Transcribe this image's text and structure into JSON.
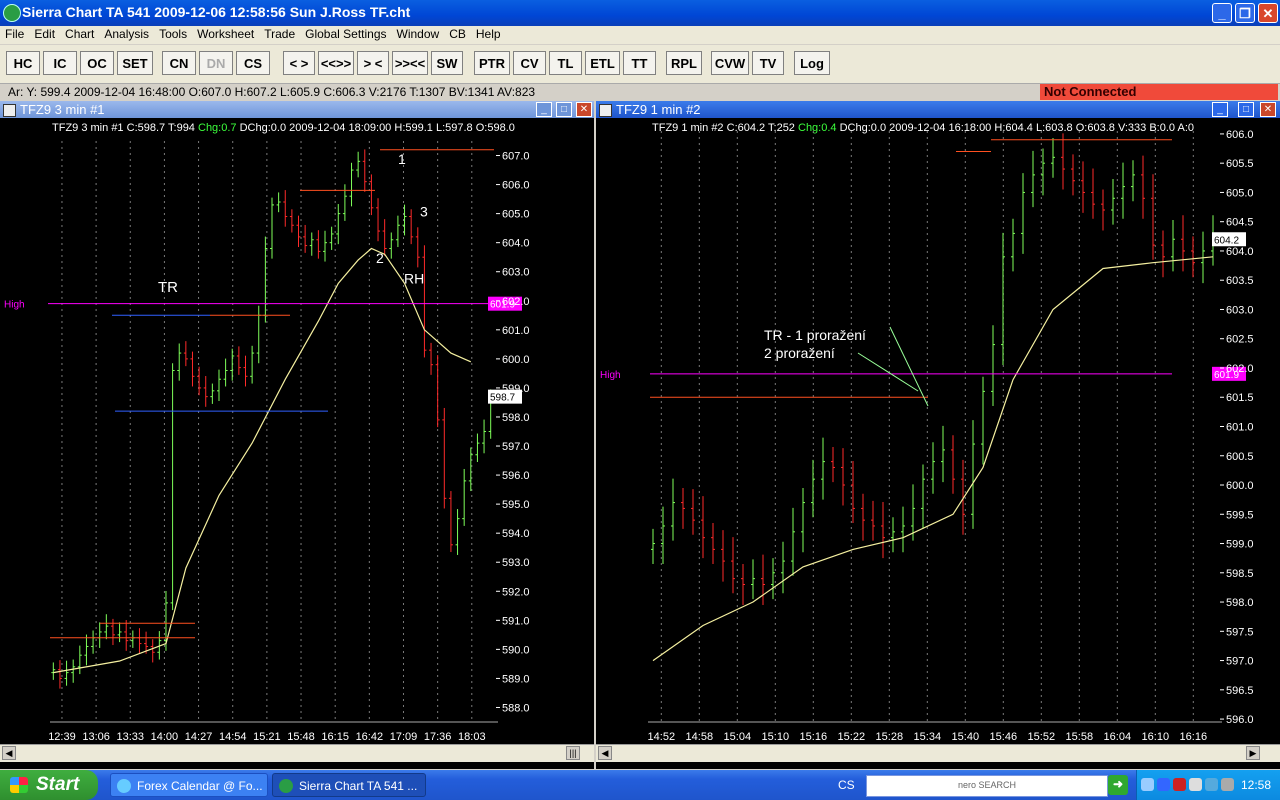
{
  "window": {
    "title": "Sierra Chart TA 541   2009-12-06   12:58:56   Sun    J.Ross TF.cht"
  },
  "menu": [
    "File",
    "Edit",
    "Chart",
    "Analysis",
    "Tools",
    "Worksheet",
    "Trade",
    "Global Settings",
    "Window",
    "CB",
    "Help"
  ],
  "toolbar": [
    "HC",
    "IC",
    "OC",
    "SET",
    "CN",
    "DN",
    "CS",
    "< >",
    "<<>>",
    "> <",
    ">><<",
    "SW",
    "PTR",
    "CV",
    "TL",
    "ETL",
    "TT",
    "RPL",
    "CVW",
    "TV",
    "Log"
  ],
  "status": {
    "info": "Ar: Y: 599.4   2009-12-04   16:48:00   O:607.0   H:607.2   L:605.9   C:606.3   V:2176   T:1307   BV:1341   AV:823",
    "connection": "Not Connected"
  },
  "chart1": {
    "window_title": "TFZ9   3 min   #1",
    "header": {
      "symbol": "TFZ9",
      "interval": "3 min",
      "num": "#1",
      "close": "C:598.7",
      "trades": "T:994",
      "chg": "Chg:0.7",
      "dchg": "DChg:0.0",
      "date": "2009-12-04",
      "time": "18:09:00",
      "high": "H:599.1",
      "low": "L:597.8",
      "open": "O:598.0"
    },
    "high_label": "High",
    "high_price_label": "601.9",
    "last_price_label": "598.7",
    "annotations": [
      "TR",
      "1",
      "2",
      "3",
      "RH"
    ]
  },
  "chart2": {
    "window_title": "TFZ9   1 min   #2",
    "header": {
      "symbol": "TFZ9",
      "interval": "1 min",
      "num": "#2",
      "close": "C:604.2",
      "trades": "T:252",
      "chg": "Chg:0.4",
      "dchg": "DChg:0.0",
      "date": "2009-12-04",
      "time": "16:18:00",
      "high": "H:604.4",
      "low": "L:603.8",
      "open": "O:603.8",
      "volume": "V:333",
      "bid": "B:0.0",
      "ask": "A:0"
    },
    "high_label": "High",
    "high_price_label": "601.9",
    "last_price_label": "604.2",
    "annotation_line1": "TR - 1 proražení",
    "annotation_line2": "2 proražení"
  },
  "chart_data": [
    {
      "type": "bar",
      "title": "TFZ9   3 min   #1",
      "ylim": [
        587.5,
        607.5
      ],
      "y_ticks": [
        "607.0",
        "606.0",
        "605.0",
        "604.0",
        "603.0",
        "602.0",
        "601.0",
        "600.0",
        "599.0",
        "598.0",
        "597.0",
        "596.0",
        "595.0",
        "594.0",
        "593.0",
        "592.0",
        "591.0",
        "590.0",
        "589.0",
        "588.0"
      ],
      "x_ticks": [
        "12:39",
        "13:06",
        "13:33",
        "14:00",
        "14:27",
        "14:54",
        "15:21",
        "15:48",
        "16:15",
        "16:42",
        "17:09",
        "17:36",
        "18:03"
      ],
      "high_line": 601.9,
      "close": [
        589.3,
        589.0,
        589.2,
        589.4,
        589.8,
        590.1,
        590.4,
        590.6,
        590.8,
        590.5,
        590.6,
        590.3,
        590.4,
        590.2,
        590.1,
        589.9,
        590.3,
        591.6,
        599.6,
        600.2,
        600.0,
        599.4,
        599.0,
        598.7,
        598.9,
        599.3,
        599.6,
        600.1,
        599.7,
        599.4,
        600.2,
        601.5,
        603.8,
        605.3,
        605.4,
        604.9,
        604.6,
        604.2,
        603.9,
        604.1,
        603.7,
        604.0,
        604.3,
        605.0,
        605.6,
        606.5,
        606.8,
        606.1,
        605.2,
        604.4,
        603.8,
        604.1,
        604.6,
        604.9,
        604.2,
        603.5,
        600.3,
        599.8,
        597.9,
        595.2,
        593.6,
        594.5,
        595.8,
        596.7,
        597.1,
        597.5,
        598.7
      ],
      "moving_average": [
        [
          0,
          589.2
        ],
        [
          10,
          589.6
        ],
        [
          17,
          590.2
        ],
        [
          20,
          592.8
        ],
        [
          25,
          595.3
        ],
        [
          30,
          597.1
        ],
        [
          35,
          599.3
        ],
        [
          40,
          601.3
        ],
        [
          43,
          602.6
        ],
        [
          46,
          603.4
        ],
        [
          48,
          603.8
        ],
        [
          50,
          603.6
        ],
        [
          53,
          602.6
        ],
        [
          56,
          601.0
        ],
        [
          60,
          600.2
        ],
        [
          63,
          599.9
        ]
      ]
    },
    {
      "type": "bar",
      "title": "TFZ9   1 min   #2",
      "ylim": [
        595.95,
        606.05
      ],
      "y_ticks": [
        "606.0",
        "605.5",
        "605.0",
        "604.5",
        "604.0",
        "603.5",
        "603.0",
        "602.5",
        "602.0",
        "601.5",
        "601.0",
        "600.5",
        "600.0",
        "599.5",
        "599.0",
        "598.5",
        "598.0",
        "597.5",
        "597.0",
        "596.5",
        "596.0"
      ],
      "x_ticks": [
        "14:52",
        "14:58",
        "15:04",
        "15:10",
        "15:16",
        "15:22",
        "15:28",
        "15:34",
        "15:40",
        "15:46",
        "15:52",
        "15:58",
        "16:04",
        "16:10",
        "16:16"
      ],
      "high_line": 601.9,
      "close": [
        599.0,
        599.3,
        599.7,
        599.6,
        599.4,
        599.1,
        598.9,
        598.7,
        598.4,
        598.3,
        598.4,
        598.3,
        598.5,
        598.7,
        599.2,
        599.7,
        600.1,
        600.4,
        600.3,
        600.0,
        599.6,
        599.4,
        599.3,
        599.1,
        599.2,
        599.3,
        599.6,
        600.1,
        600.4,
        600.6,
        600.1,
        599.5,
        600.7,
        601.6,
        602.4,
        603.9,
        604.3,
        605.0,
        605.3,
        605.5,
        605.6,
        605.4,
        605.2,
        605.0,
        604.8,
        604.7,
        604.9,
        605.1,
        605.3,
        604.9,
        604.1,
        603.9,
        604.2,
        604.0,
        603.8,
        604.0,
        604.2
      ],
      "moving_average": [
        [
          0,
          597.0
        ],
        [
          5,
          597.6
        ],
        [
          10,
          598.0
        ],
        [
          15,
          598.6
        ],
        [
          20,
          598.9
        ],
        [
          25,
          599.1
        ],
        [
          30,
          599.5
        ],
        [
          33,
          600.3
        ],
        [
          36,
          601.8
        ],
        [
          40,
          603.0
        ],
        [
          45,
          603.7
        ],
        [
          50,
          603.8
        ],
        [
          56,
          603.9
        ]
      ]
    }
  ],
  "taskbar": {
    "start": "Start",
    "tasks": [
      "Forex Calendar @ Fo...",
      "Sierra Chart TA 541 ..."
    ],
    "lang": "CS",
    "search": "nero SEARCH",
    "clock": "12:58"
  },
  "colors": {
    "bull": "#7fff5a",
    "bear": "#ff2a2a",
    "ma": "#f5f0a0",
    "high_line": "#ff00ff",
    "tr_lines": "#3060ff",
    "range_lines": "#ff5020"
  }
}
